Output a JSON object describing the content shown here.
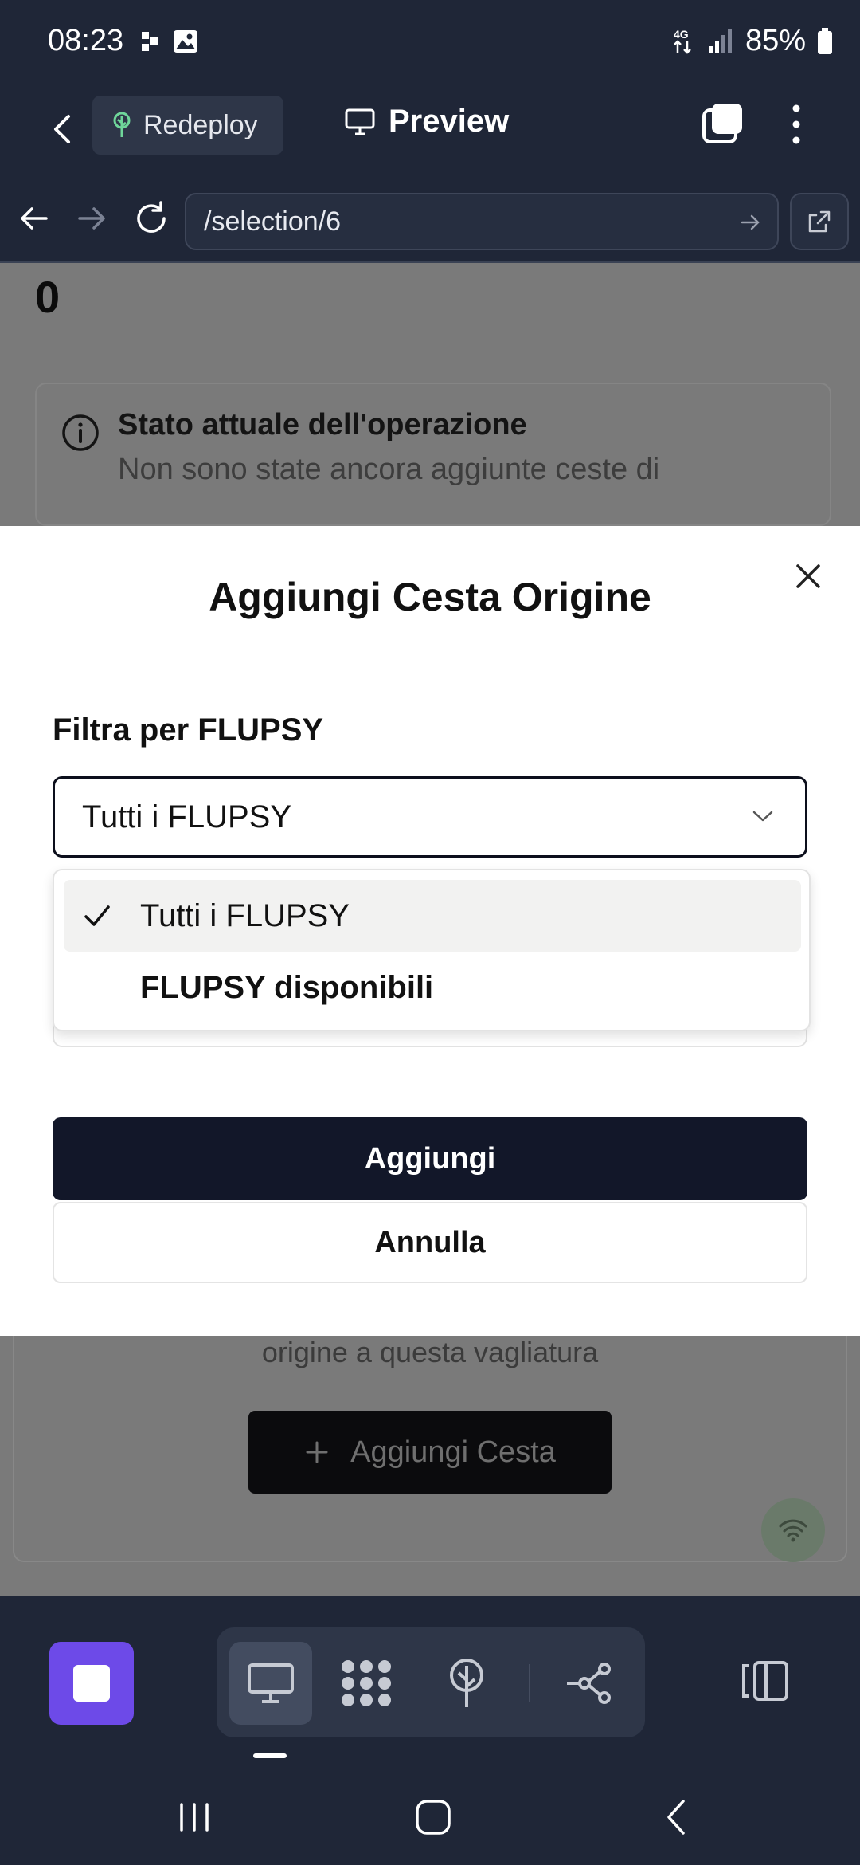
{
  "status_bar": {
    "time": "08:23",
    "network": "4G",
    "battery": "85%"
  },
  "app_header": {
    "redeploy_label": "Redeploy",
    "preview_label": "Preview"
  },
  "browser": {
    "url": "/selection/6"
  },
  "page": {
    "counter_value": "0",
    "info_title": "Stato attuale dell'operazione",
    "info_text": "Non sono state ancora aggiunte ceste di",
    "lower_text": "origine a questa vagliatura",
    "add_button": "Aggiungi Cesta"
  },
  "modal": {
    "title": "Aggiungi Cesta Origine",
    "filter_label": "Filtra per FLUPSY",
    "selected_value": "Tutti i FLUPSY",
    "options": [
      {
        "label": "Tutti i FLUPSY",
        "selected": true
      },
      {
        "label": "FLUPSY disponibili",
        "selected": false
      }
    ],
    "primary_button": "Aggiungi",
    "secondary_button": "Annulla"
  },
  "colors": {
    "header_bg": "#1f2637",
    "accent_purple": "#6d4ae8",
    "primary_button_bg": "#121729"
  }
}
